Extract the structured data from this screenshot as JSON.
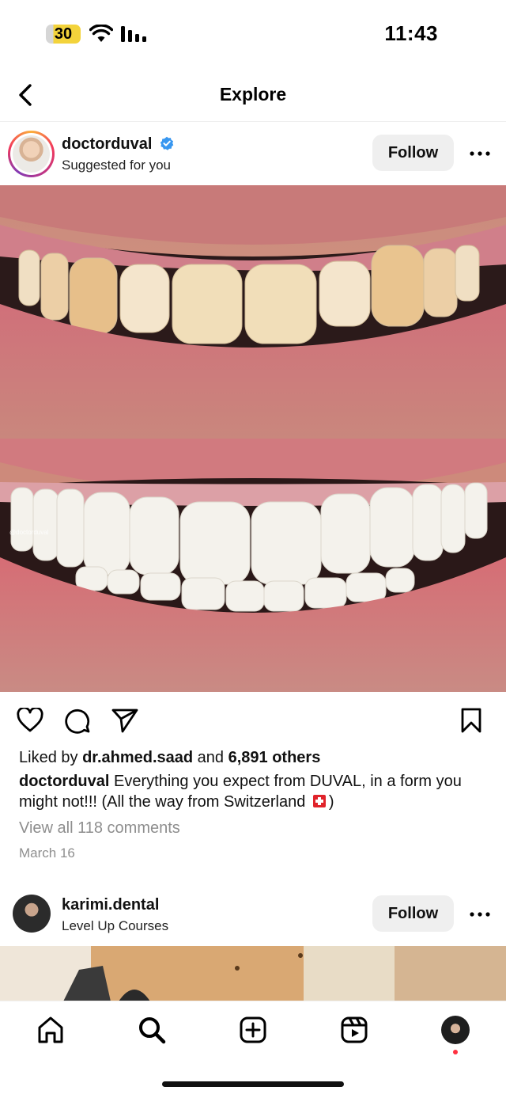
{
  "status_bar": {
    "battery": "30",
    "time": "11:43"
  },
  "header": {
    "title": "Explore",
    "back_icon": "chevron-left-icon"
  },
  "post": {
    "username": "doctorduval",
    "verified": true,
    "subtitle": "Suggested for you",
    "follow_label": "Follow",
    "watermark": "@doctorduval",
    "likes_prefix": "Liked by ",
    "likes_user": "dr.ahmed.saad",
    "likes_mid": " and ",
    "likes_count": "6,891 others",
    "caption_user": "doctorduval",
    "caption_text": "Everything you expect from DUVAL, in a form you might not!!! (All the way from Switzerland",
    "caption_end": ")",
    "view_comments": "View all 118 comments",
    "date": "March 16"
  },
  "next_post": {
    "username": "karimi.dental",
    "subtitle": "Level Up Courses",
    "follow_label": "Follow"
  },
  "colors": {
    "verified_blue": "#3897f0",
    "notification_red": "#ff3040",
    "muted_text": "#8e8e8e",
    "follow_bg": "#efefef"
  }
}
